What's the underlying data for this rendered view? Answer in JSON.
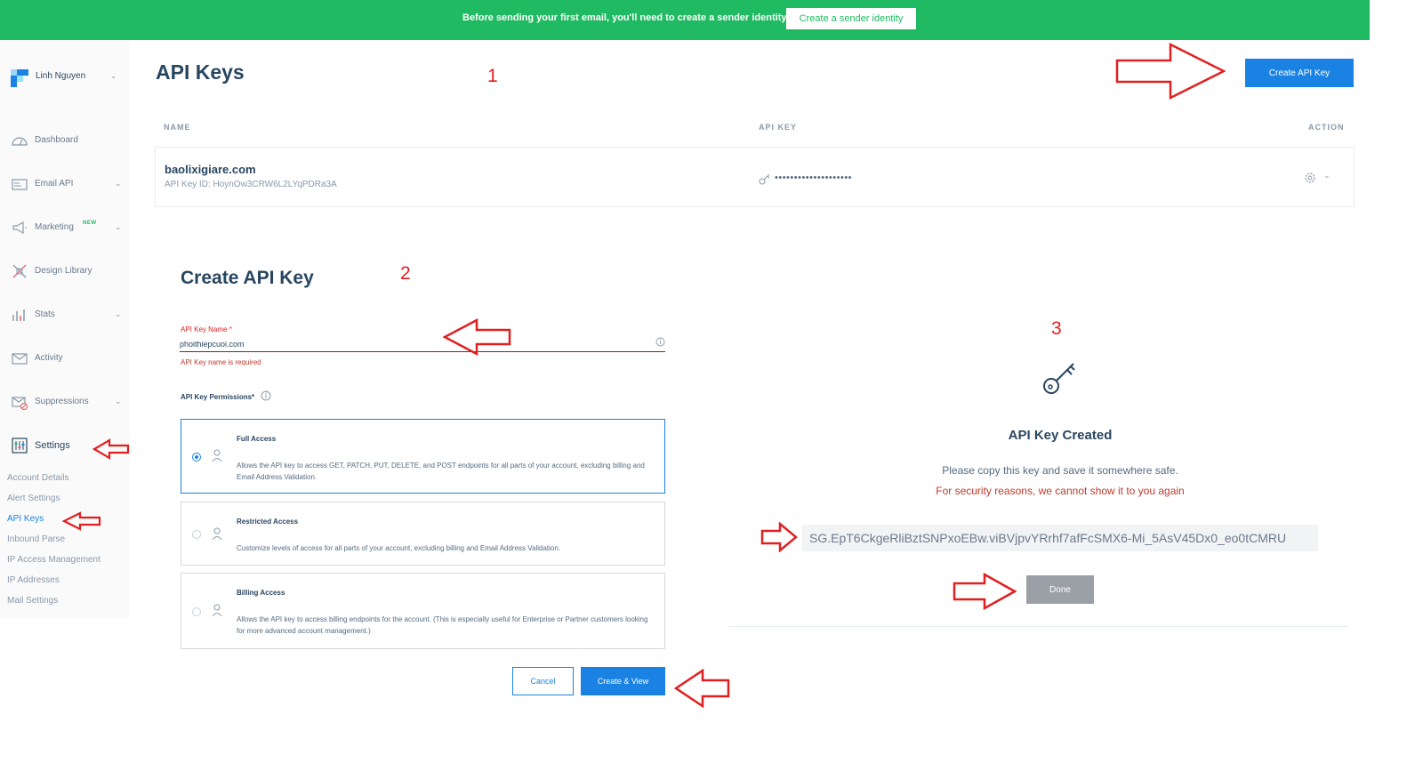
{
  "banner": {
    "text": "Before sending your first email, you'll need to create a sender identity.",
    "button_label": "Create a sender identity"
  },
  "sidebar": {
    "user_name": "Linh Nguyen",
    "items": [
      {
        "label": "Dashboard",
        "icon": "dashboard-icon"
      },
      {
        "label": "Email API",
        "icon": "email-api-icon",
        "chevron": true
      },
      {
        "label": "Marketing",
        "icon": "megaphone-icon",
        "badge": "NEW",
        "chevron": true
      },
      {
        "label": "Design Library",
        "icon": "design-library-icon"
      },
      {
        "label": "Stats",
        "icon": "stats-icon",
        "chevron": true
      },
      {
        "label": "Activity",
        "icon": "activity-icon"
      },
      {
        "label": "Suppressions",
        "icon": "suppressions-icon",
        "chevron": true
      },
      {
        "label": "Settings",
        "icon": "settings-icon"
      }
    ],
    "settings_sub": [
      "Account Details",
      "Alert Settings",
      "API Keys",
      "Inbound Parse",
      "IP Access Management",
      "IP Addresses",
      "Mail Settings"
    ],
    "active_sub": "API Keys"
  },
  "main": {
    "title": "API Keys",
    "create_button": "Create API Key",
    "table": {
      "headers": {
        "name": "NAME",
        "api_key": "API KEY",
        "action": "ACTION"
      },
      "rows": [
        {
          "name": "baolixigiare.com",
          "id_label": "API Key ID: HoynOw3CRW6L2LYqPDRa3A",
          "masked": "••••••••••••••••••••"
        }
      ]
    }
  },
  "annotations": {
    "step1": "1",
    "step2": "2",
    "step3": "3"
  },
  "form": {
    "title": "Create API Key",
    "name_label": "API Key Name *",
    "name_value": "phoithiepcuoi.com",
    "name_error": "API Key name is required",
    "permissions_label": "API Key Permissions*",
    "permissions": [
      {
        "title": "Full Access",
        "desc": "Allows the API key to access GET, PATCH, PUT, DELETE, and POST endpoints for all parts of your account, excluding billing and Email Address Validation.",
        "selected": true
      },
      {
        "title": "Restricted Access",
        "desc": "Customize levels of access for all parts of your account, excluding billing and Email Address Validation.",
        "selected": false
      },
      {
        "title": "Billing Access",
        "desc": "Allows the API key to access billing endpoints for the account. (This is especially useful for Enterprise or Partner customers looking for more advanced account management.)",
        "selected": false
      }
    ],
    "cancel_label": "Cancel",
    "create_label": "Create & View"
  },
  "created": {
    "title": "API Key Created",
    "message": "Please copy this key and save it somewhere safe.",
    "warning": "For security reasons, we cannot show it to you again",
    "key": "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",
    "done_label": "Done"
  },
  "colors": {
    "banner": "#1fba62",
    "primary": "#1a82e2",
    "annotation": "#e02020",
    "text": "#294661"
  }
}
